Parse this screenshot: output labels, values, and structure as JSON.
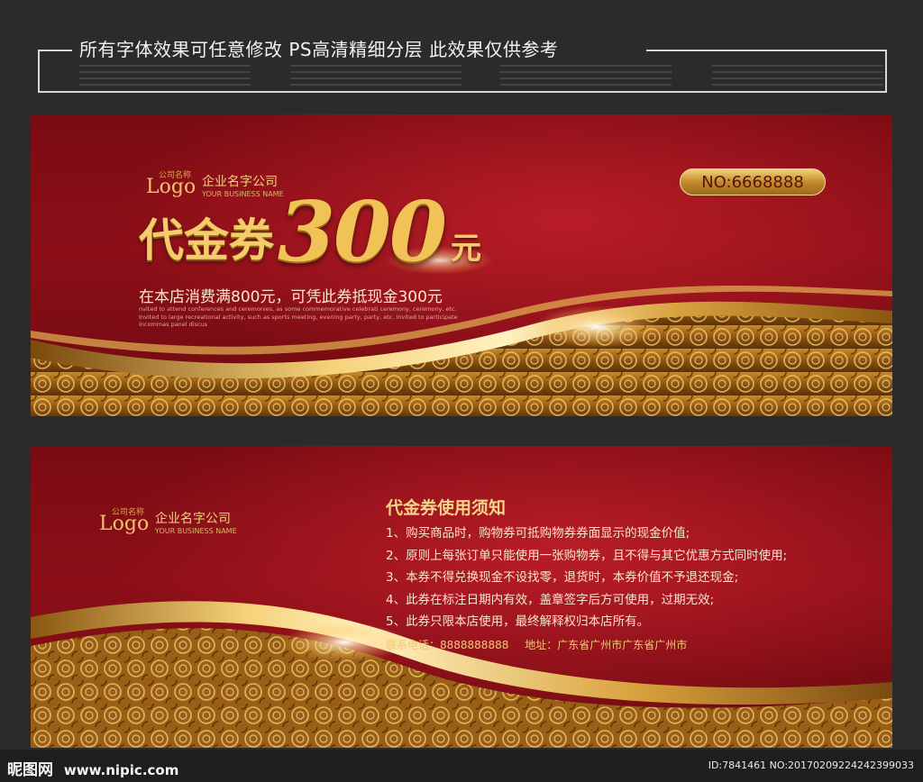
{
  "header": {
    "banner_text": "所有字体效果可任意修改  PS高清精细分层  此效果仅供参考"
  },
  "front": {
    "logo": {
      "small": "公司名称",
      "word": "Logo",
      "company": "企业名字公司",
      "sub": "YOUR BUSINESS NAME"
    },
    "serial": "NO:6668888",
    "title": "代金券",
    "amount": "300",
    "unit": "元",
    "subtitle": "在本店消费满800元，可凭此券抵现金300元",
    "description": "nvited to attend conferences and ceremonies, as some commemorative celebrati ceremony, ceremony, etc. Invited to large recreational activity, such as sports meeting, evening party, party, etc. Invited to participate incommas panel discus"
  },
  "back": {
    "logo": {
      "small": "公司名称",
      "word": "Logo",
      "company": "企业名字公司",
      "sub": "YOUR BUSINESS NAME"
    },
    "rules_title": "代金券使用须知",
    "rules": [
      "1、购买商品时，购物券可抵购物券券面显示的现金价值;",
      "2、原则上每张订单只能使用一张购物券，且不得与其它优惠方式同时使用;",
      "3、本券不得兑换现金不设找零，退货时，本券价值不予退还现金;",
      "4、此券在标注日期内有效，盖章签字后方可使用，过期无效;",
      "5、此券只限本店使用，最终解释权归本店所有。"
    ],
    "phone": "联系电话：8888888888",
    "address": "地址：广东省广州市广东省广州市"
  },
  "watermark": {
    "site_name": "昵图网",
    "site_url": "www.nipic.com",
    "id_text": "ID:7841461 NO:20170209224242399033"
  },
  "colors": {
    "background": "#2b2b2b",
    "card_red": "#8c0f18",
    "gold": "#f1c357",
    "gold_dark": "#9c6a1d"
  }
}
